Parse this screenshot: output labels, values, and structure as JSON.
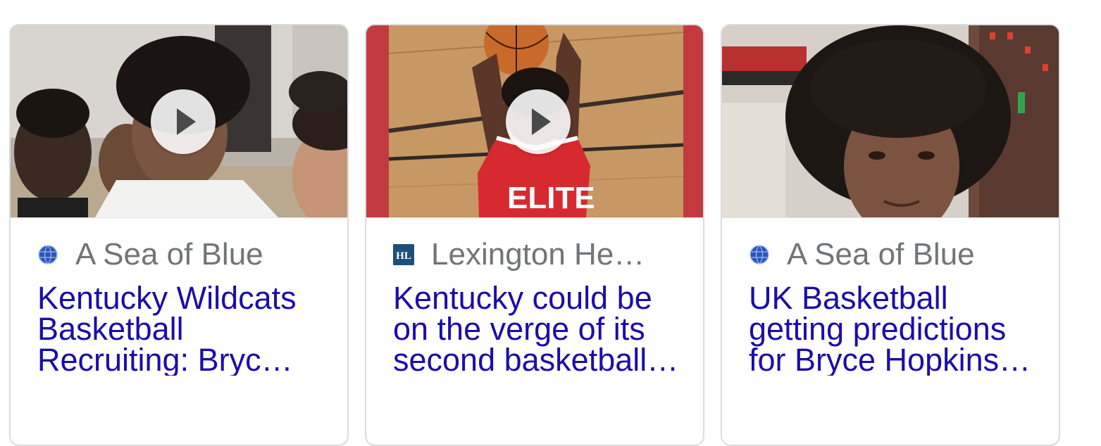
{
  "cards": [
    {
      "source": "A Sea of Blue",
      "favicon": "sbnation-globe-icon",
      "headline": "Kentucky Wildcats Basketball Recruiting: Bryc…",
      "has_video": true
    },
    {
      "source": "Lexington He…",
      "favicon": "lexington-herald-hl-icon",
      "favicon_text": "HL",
      "headline": "Kentucky could be on the verge of its second basketball…",
      "has_video": true
    },
    {
      "source": "A Sea of Blue",
      "favicon": "sbnation-globe-icon",
      "headline": "UK Basketball getting predictions for Bryce Hopkins…",
      "has_video": false
    }
  ],
  "colors": {
    "headline": "#1a0dab",
    "source": "#70757a",
    "card_border": "#dadce0"
  }
}
